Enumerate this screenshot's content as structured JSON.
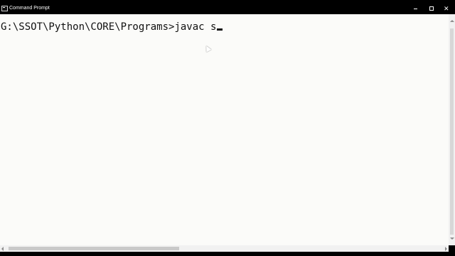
{
  "window": {
    "title": "Command Prompt",
    "icon": "command-prompt-icon",
    "controls": {
      "minimize": "minimize-icon",
      "maximize": "maximize-icon",
      "close": "✕"
    }
  },
  "console": {
    "prompt": "G:\\SSOT\\Python\\CORE\\Programs>",
    "command": "javac s",
    "cursor_icon": "text-cursor",
    "pointer_icon": "mouse-pointer-icon"
  },
  "scrollbars": {
    "vertical": "vertical-scrollbar",
    "horizontal": "horizontal-scrollbar"
  },
  "colors": {
    "titlebar": "#000000",
    "console_background": "#fbfbf9",
    "text": "#101010"
  }
}
